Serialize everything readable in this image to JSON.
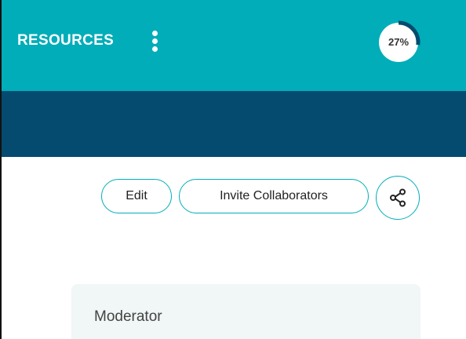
{
  "header": {
    "title": "RESOURCES",
    "menu_icon": "kebab-vertical-icon",
    "progress": {
      "percent": 27,
      "label": "27%",
      "track_color": "#ffffff",
      "fill_color": "#054b70"
    }
  },
  "actions": {
    "edit_label": "Edit",
    "invite_label": "Invite Collaborators",
    "share_icon": "share-icon"
  },
  "card": {
    "label": "Moderator"
  },
  "colors": {
    "header_bg": "#00adb9",
    "subheader_bg": "#054b70",
    "accent": "#00adb9",
    "card_bg": "#f1f6f6"
  }
}
